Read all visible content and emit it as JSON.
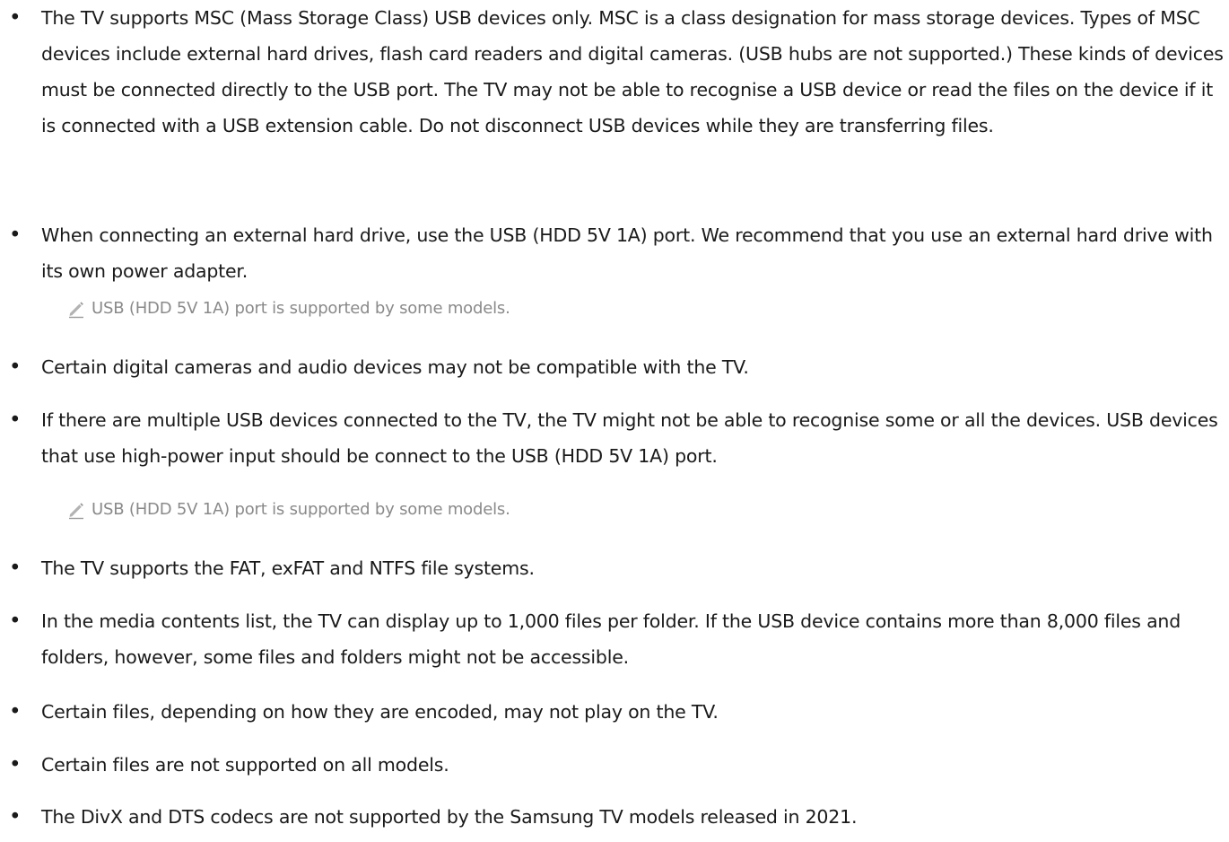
{
  "bullets": [
    {
      "text": "The TV supports MSC (Mass Storage Class) USB devices only. MSC is a class designation for mass storage devices. Types of MSC devices include external hard drives, flash card readers and digital cameras. (USB hubs are not supported.) These kinds of devices must be connected directly to the USB port. The TV may not be able to recognise a USB device or read the files on the device if it is connected with a USB extension cable. Do not disconnect USB devices while they are transferring files."
    },
    {
      "text": "When connecting an external hard drive, use the USB (HDD 5V 1A) port. We recommend that you use an external hard drive with its own power adapter.",
      "note": "USB (HDD 5V 1A) port is supported by some models."
    },
    {
      "text": "Certain digital cameras and audio devices may not be compatible with the TV."
    },
    {
      "text": "If there are multiple USB devices connected to the TV, the TV might not be able to recognise some or all the devices. USB devices that use high-power input should be connect to the USB (HDD 5V 1A) port.",
      "note": "USB (HDD 5V 1A) port is supported by some models."
    },
    {
      "text": "The TV supports the FAT, exFAT and NTFS file systems."
    },
    {
      "text": "In the media contents list, the TV can display up to 1,000 files per folder. If the USB device contains more than 8,000 files and folders, however, some files and folders might not be accessible."
    },
    {
      "text": "Certain files, depending on how they are encoded, may not play on the TV."
    },
    {
      "text": "Certain files are not supported on all models."
    },
    {
      "text": "The DivX and DTS codecs are not supported by the Samsung TV models released in 2021."
    }
  ],
  "icons": {
    "note": "pencil-icon"
  },
  "colors": {
    "text": "#1a1a1a",
    "note_text": "#8a8a8a"
  }
}
